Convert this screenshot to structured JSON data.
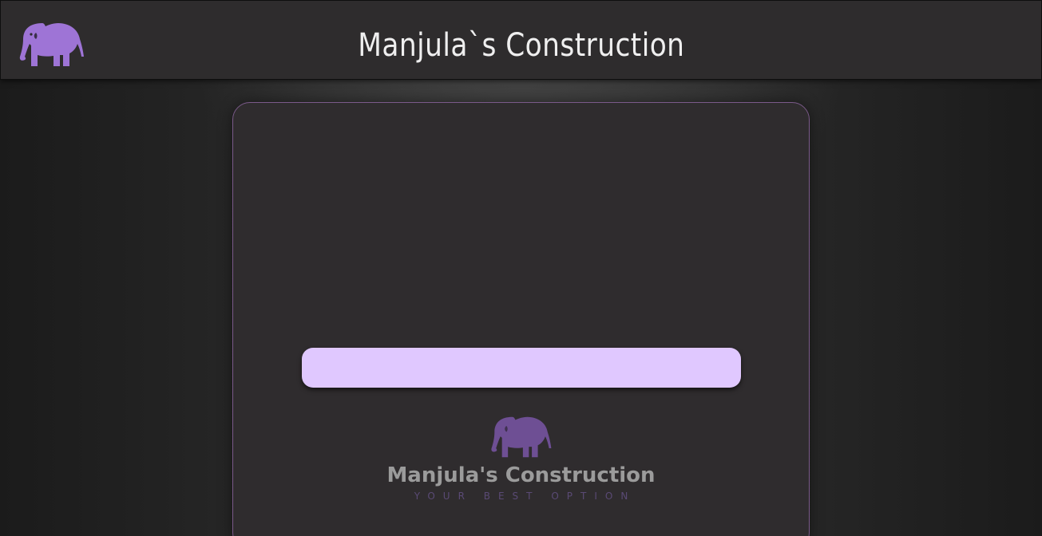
{
  "header": {
    "title": "Manjula`s Construction",
    "logo_icon": "elephant-icon",
    "logo_color": "#9e74d6"
  },
  "card": {
    "border_color": "#7b5a8a",
    "bar_color": "#e0c8ff",
    "brand": {
      "icon": "elephant-icon",
      "icon_color": "#6e4f94",
      "name": "Manjula's Construction",
      "tagline": "YOUR BEST OPTION"
    }
  }
}
